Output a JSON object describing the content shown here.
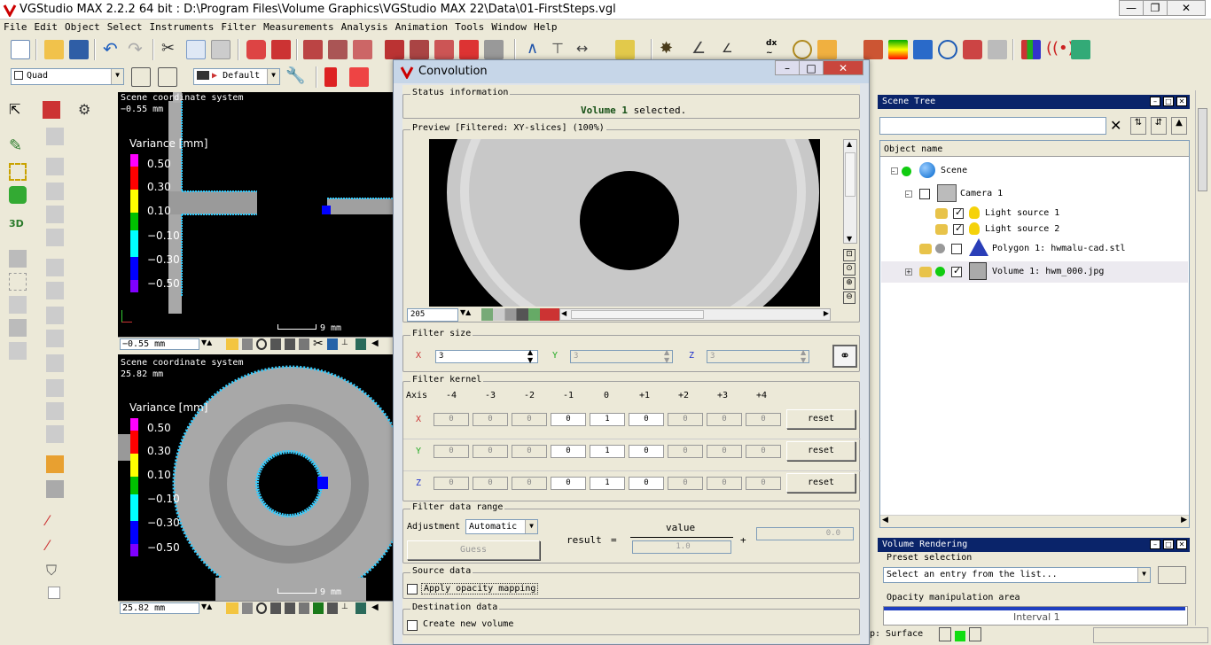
{
  "window": {
    "title": "VGStudio MAX 2.2.2 64 bit :  D:\\Program Files\\Volume Graphics\\VGStudio MAX 22\\Data\\01-FirstSteps.vgl",
    "min": "—",
    "max": "❐",
    "close": "✕"
  },
  "menu": [
    "File",
    "Edit",
    "Object",
    "Select",
    "Instruments",
    "Filter",
    "Measurements",
    "Analysis",
    "Animation",
    "Tools",
    "Window",
    "Help"
  ],
  "toolbar2": {
    "layout": "Quad",
    "preset": "Default"
  },
  "viewports": {
    "top": {
      "coord_label": "Scene coordinate system",
      "coord_value": "−0.55 mm",
      "legend_title": "Variance [mm]",
      "legend_ticks": [
        "0.50",
        "0.30",
        "0.10",
        "−0.10",
        "−0.30",
        "−0.50"
      ],
      "scale": "9 mm",
      "bar_value": "−0.55 mm"
    },
    "bottom": {
      "coord_label": "Scene coordinate system",
      "coord_value": "25.82 mm",
      "legend_title": "Variance [mm]",
      "legend_ticks": [
        "0.50",
        "0.30",
        "0.10",
        "−0.10",
        "−0.30",
        "−0.50"
      ],
      "scale": "9 mm",
      "bar_value": "25.82 mm"
    }
  },
  "legend_colors": [
    "#ff00ff",
    "#ff0000",
    "#ffff00",
    "#00c000",
    "#00ffff",
    "#0000ff",
    "#8000ff"
  ],
  "dialog": {
    "title": "Convolution",
    "status_group": "Status information",
    "status_obj": "Volume 1",
    "status_rest": " selected.",
    "preview_group": "Preview [Filtered: XY-slices] (100%)",
    "slice": "205",
    "filter_size_group": "Filter size",
    "size": {
      "x_label": "X",
      "x": "3",
      "y_label": "Y",
      "y": "3",
      "z_label": "Z",
      "z": "3"
    },
    "kernel_group": "Filter kernel",
    "axis_label": "Axis",
    "kernel_cols": [
      "-4",
      "-3",
      "-2",
      "-1",
      "0",
      "+1",
      "+2",
      "+3",
      "+4"
    ],
    "kernel_rows": [
      {
        "axis": "X",
        "values": [
          "0",
          "0",
          "0",
          "0",
          "1",
          "0",
          "0",
          "0",
          "0"
        ],
        "reset": "reset"
      },
      {
        "axis": "Y",
        "values": [
          "0",
          "0",
          "0",
          "0",
          "1",
          "0",
          "0",
          "0",
          "0"
        ],
        "reset": "reset"
      },
      {
        "axis": "Z",
        "values": [
          "0",
          "0",
          "0",
          "0",
          "1",
          "0",
          "0",
          "0",
          "0"
        ],
        "reset": "reset"
      }
    ],
    "range_group": "Filter data range",
    "adjustment_label": "Adjustment",
    "adjustment_value": "Automatic",
    "guess": "Guess",
    "result_label": "result",
    "equals": "=",
    "numerator": "value",
    "denominator": "1.0",
    "plus": "+",
    "offset": "0.0",
    "source_group": "Source data",
    "apply_opacity": "Apply opacity mapping",
    "dest_group": "Destination data",
    "create_new": "Create new volume"
  },
  "scene_tree": {
    "title": "Scene Tree",
    "column": "Object name",
    "items": [
      {
        "label": "Scene"
      },
      {
        "label": "Camera 1"
      },
      {
        "label": "Light source 1"
      },
      {
        "label": "Light source 2"
      },
      {
        "label": "Polygon 1: hwmalu-cad.stl"
      },
      {
        "label": "Volume 1: hwm_000.jpg"
      }
    ]
  },
  "volume_rendering": {
    "title": "Volume Rendering",
    "preset_group": "Preset selection",
    "preset_placeholder": "Select an entry from the list...",
    "opacity_group": "Opacity manipulation area",
    "interval": "Interval 1"
  },
  "status": {
    "mode": "p: Surface"
  }
}
